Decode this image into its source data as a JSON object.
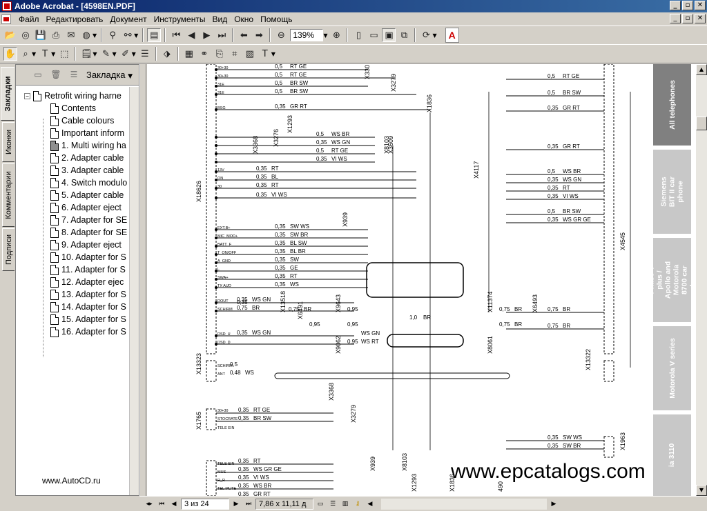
{
  "window": {
    "title": "Adobe Acrobat - [4598EN.PDF]",
    "controls": [
      "_",
      "▫",
      "✕"
    ]
  },
  "menu": [
    "Файл",
    "Редактировать",
    "Документ",
    "Инструменты",
    "Вид",
    "Окно",
    "Помощь"
  ],
  "toolbar": {
    "zoom_value": "139%",
    "icons": [
      "open-icon",
      "acquire-icon",
      "save-icon",
      "print-icon",
      "email-icon",
      "search-icon",
      "find-icon",
      "show-navigation-icon",
      "first-page-icon",
      "previous-page-icon",
      "next-page-icon",
      "last-page-icon",
      "go-back-icon",
      "go-forward-icon",
      "zoom-out-icon",
      "zoom-in-icon",
      "actual-size-icon",
      "fit-page-icon",
      "fit-width-icon",
      "rotate-icon",
      "adobe-logo-icon"
    ]
  },
  "toolbar2": {
    "icons": [
      "hand-tool-icon",
      "zoom-tool-icon",
      "text-select-icon",
      "graphics-select-icon",
      "note-tool-icon",
      "pencil-tool-icon",
      "highlight-tool-icon",
      "touchup-text-icon",
      "crop-icon",
      "form-tool-icon",
      "link-tool-icon",
      "article-tool-icon",
      "movie-tool-icon",
      "typewriter-icon"
    ]
  },
  "side_tabs": [
    "Закладки",
    "Иконки",
    "Комментарии",
    "Подписи"
  ],
  "bookmarks": {
    "menu_label": "Закладка",
    "items": [
      "Retrofit wiring harne",
      "Contents",
      "Cable colours",
      "Important inform",
      "1. Multi wiring ha",
      "2. Adapter cable",
      "3. Adapter cable",
      "4. Switch modulo",
      "5. Adapter cable",
      "6. Adapter eject",
      "7. Adapter for SE",
      "8. Adapter for SE",
      "9. Adapter eject",
      "10. Adapter for S",
      "11. Adapter for S",
      "12. Adapter ejec",
      "13. Adapter for S",
      "14. Adapter for S",
      "15. Adapter for S",
      "16. Adapter for S"
    ],
    "watermark": "www.AutoCD.ru"
  },
  "index_tabs": [
    "All telephones",
    "Siemens BIT II car phone",
    "Phase V plus / Apollo and Motorola 8700 car phone",
    "Motorola V series",
    "ia 3110"
  ],
  "watermark": "www.epcatalogs.com",
  "status": {
    "page": "3 из 24",
    "size": "7,86 x 11,11 д"
  },
  "diagram": {
    "connectors": [
      "X18626",
      "X4545",
      "X13323",
      "X13322",
      "X1765",
      "X1963",
      "X330",
      "X3279",
      "X1836",
      "X1293",
      "X3276",
      "X3368",
      "X8103",
      "X4117",
      "X3609",
      "X939",
      "X13518",
      "X6491",
      "X9643",
      "X11374",
      "X6493",
      "X9062",
      "X8061",
      "X3368",
      "X3279",
      "X939",
      "X8103",
      "X1293",
      "X1836",
      "490"
    ],
    "left_pins": [
      "30+30",
      "30+30",
      "31E",
      "31E",
      "BSG",
      "13V",
      "ON",
      "30",
      "EXT.B+",
      "MIC_MOD+",
      "BATT_F",
      "T_ON/OFF",
      "A_GND",
      "L",
      "SWA+",
      "TX AUD",
      "DOUT",
      "SCHIRM",
      "DSD_U",
      "DSD_D",
      "SCHIRM",
      "ANT",
      "30+30",
      "STOCRATE",
      "TELE EIN",
      "TELE EIN",
      "MUS",
      "R_R",
      "TEL MUTE"
    ],
    "wires": [
      {
        "size": "0,5",
        "color": "RT GE"
      },
      {
        "size": "0,5",
        "color": "RT GE"
      },
      {
        "size": "0,5",
        "color": "BR SW"
      },
      {
        "size": "0,5",
        "color": "BR SW"
      },
      {
        "size": "0,35",
        "color": "GR RT"
      },
      {
        "size": "0,5",
        "color": "WS BR"
      },
      {
        "size": "0,35",
        "color": "WS GN"
      },
      {
        "size": "0,5",
        "color": "RT GE"
      },
      {
        "size": "0,35",
        "color": "VI WS"
      },
      {
        "size": "0,35",
        "color": "RT"
      },
      {
        "size": "0,35",
        "color": "BL"
      },
      {
        "size": "0,35",
        "color": "RT"
      },
      {
        "size": "0,35",
        "color": "VI WS"
      },
      {
        "size": "0,35",
        "color": "SW WS"
      },
      {
        "size": "0,35",
        "color": "SW BR"
      },
      {
        "size": "0,35",
        "color": "BL SW"
      },
      {
        "size": "0,35",
        "color": "BL BR"
      },
      {
        "size": "0,35",
        "color": "SW"
      },
      {
        "size": "0,35",
        "color": "GE"
      },
      {
        "size": "0,35",
        "color": "RT"
      },
      {
        "size": "0,35",
        "color": "WS"
      },
      {
        "size": "0,35",
        "color": "WS GN"
      },
      {
        "size": "0,75",
        "color": "BR"
      },
      {
        "size": "0,35",
        "color": "WS GN"
      },
      {
        "size": "0,5",
        "color": ""
      },
      {
        "size": "0,48",
        "color": "WS"
      }
    ],
    "right_wires": [
      {
        "size": "0,5",
        "color": "RT GE"
      },
      {
        "size": "0,5",
        "color": "BR SW"
      },
      {
        "size": "0,35",
        "color": "GR RT"
      },
      {
        "size": "0,35",
        "color": "GR RT"
      },
      {
        "size": "0,5",
        "color": "WS BR"
      },
      {
        "size": "0,35",
        "color": "WS GN"
      },
      {
        "size": "0,35",
        "color": "RT"
      },
      {
        "size": "0,35",
        "color": "VI WS"
      },
      {
        "size": "0,5",
        "color": "BR SW"
      },
      {
        "size": "0,35",
        "color": "WS GR GE"
      },
      {
        "size": "0,75",
        "color": "BR"
      },
      {
        "size": "0,75",
        "color": "BR"
      },
      {
        "size": "0,35",
        "color": "SW WS"
      },
      {
        "size": "0,35",
        "color": "SW BR"
      }
    ],
    "middle_labels": [
      "0,35",
      "0,75",
      "BR",
      "0,95",
      "1,0",
      "BR",
      "0,75",
      "BR",
      "0,95",
      "WS GN",
      "0,95",
      "WS RT",
      "0,75",
      "BR",
      "0,95"
    ],
    "bottom_wires": [
      {
        "size": "0,35",
        "color": "RT GE"
      },
      {
        "size": "0,35",
        "color": "BR SW"
      },
      {
        "size": "0,35",
        "color": "RT"
      },
      {
        "size": "0,35",
        "color": "WS GR GE"
      },
      {
        "size": "0,35",
        "color": "VI WS"
      },
      {
        "size": "0,35",
        "color": "WS BR"
      },
      {
        "size": "0,35",
        "color": "GR RT"
      }
    ]
  }
}
